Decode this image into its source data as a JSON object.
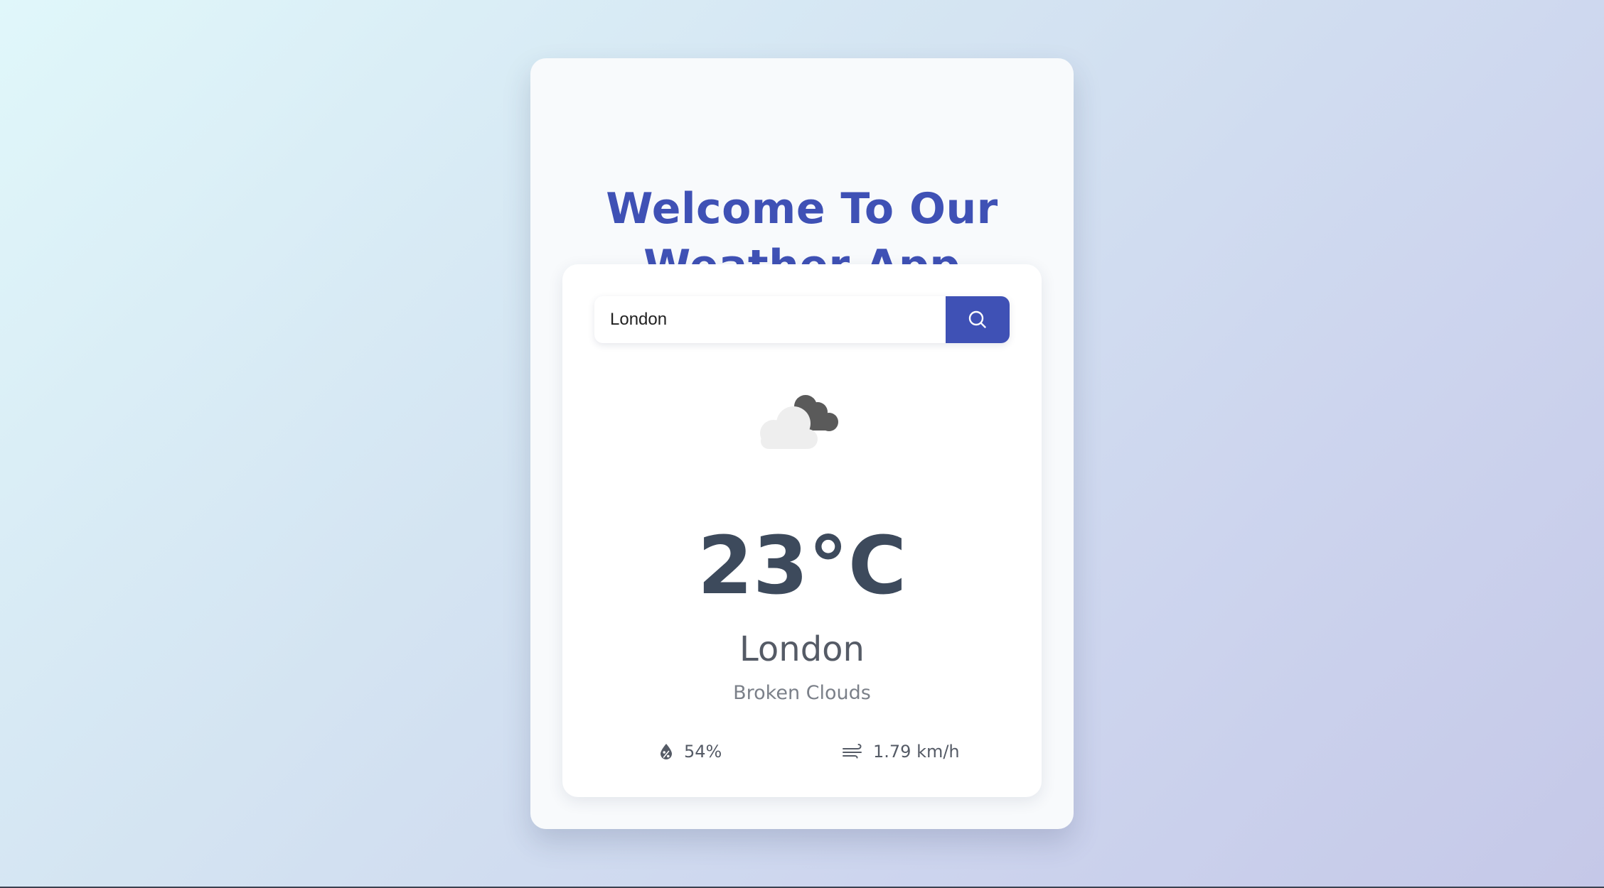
{
  "header": {
    "title_line1": "Welcome To Our",
    "title_line2": "Weather App"
  },
  "search": {
    "value": "London",
    "button_icon": "search-icon"
  },
  "weather": {
    "icon": "broken-clouds-icon",
    "temperature": "23°C",
    "city": "London",
    "description": "Broken Clouds",
    "humidity": "54%",
    "humidity_icon": "humidity-icon",
    "wind": "1.79 km/h",
    "wind_icon": "wind-icon"
  },
  "colors": {
    "accent": "#3f51b5",
    "temperature_text": "#3d4a5c",
    "card_background": "#ffffff"
  }
}
